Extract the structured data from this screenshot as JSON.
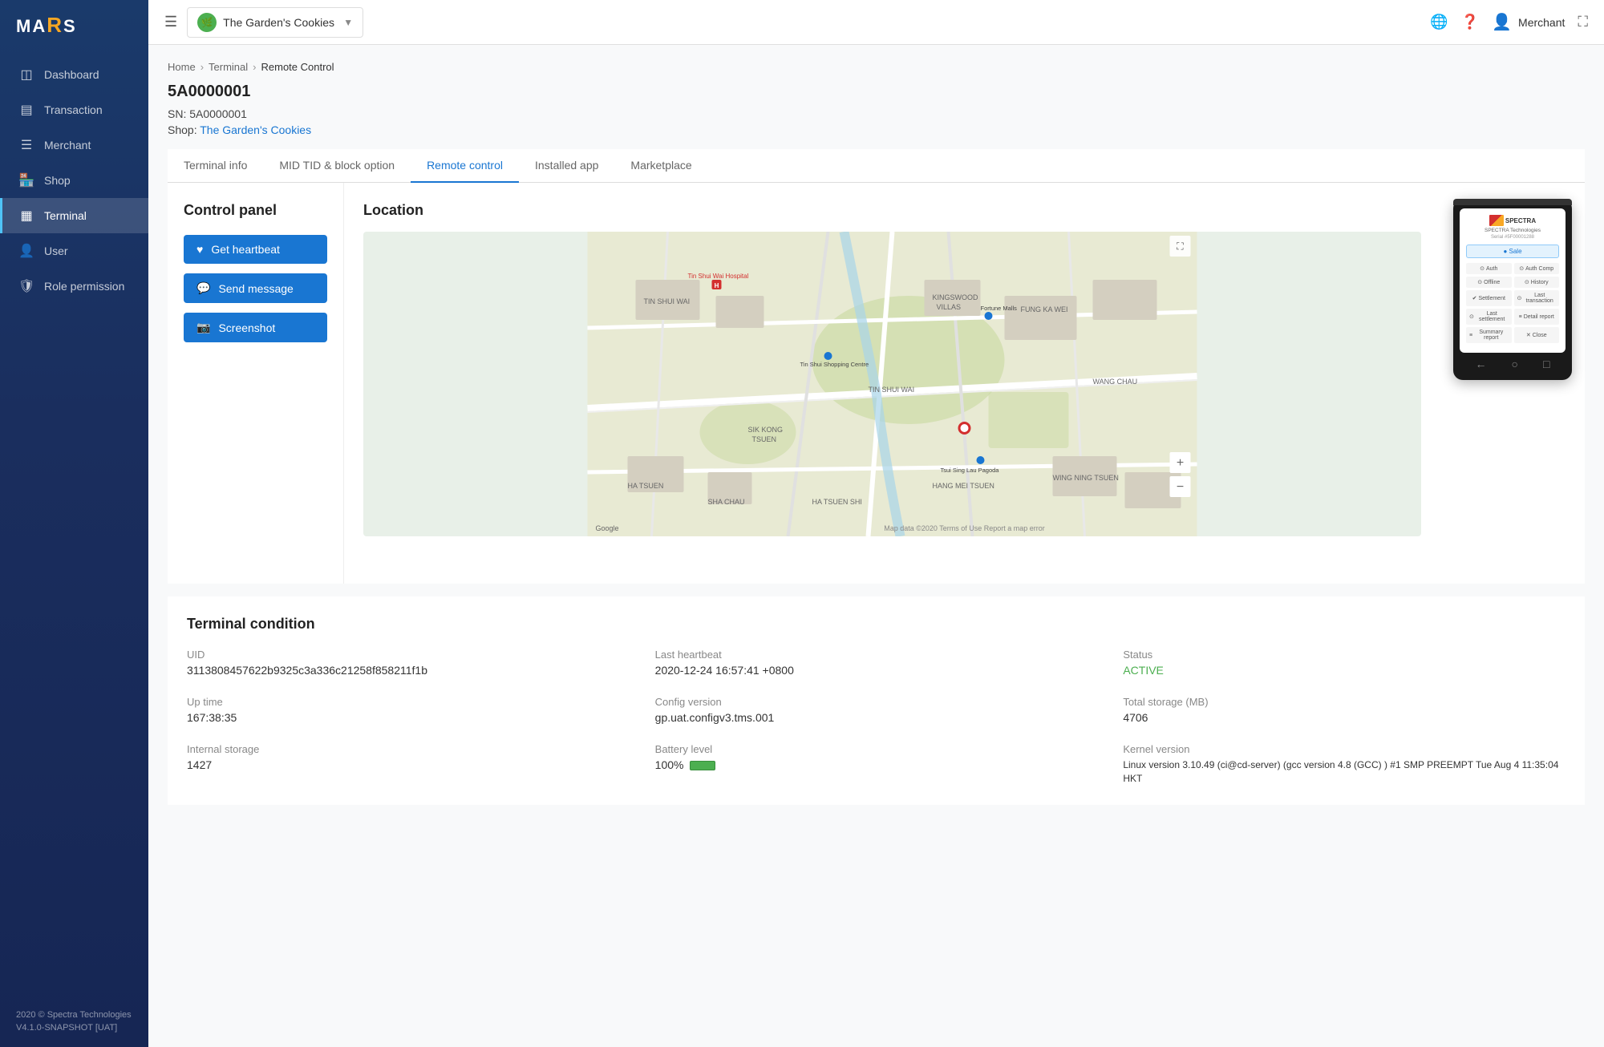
{
  "sidebar": {
    "logo": "MARS",
    "nav_items": [
      {
        "id": "dashboard",
        "label": "Dashboard",
        "icon": "🏠",
        "active": false
      },
      {
        "id": "transaction",
        "label": "Transaction",
        "icon": "💳",
        "active": false
      },
      {
        "id": "merchant",
        "label": "Merchant",
        "icon": "📋",
        "active": false
      },
      {
        "id": "shop",
        "label": "Shop",
        "icon": "🏪",
        "active": false
      },
      {
        "id": "terminal",
        "label": "Terminal",
        "icon": "🖥",
        "active": true
      },
      {
        "id": "user",
        "label": "User",
        "icon": "👤",
        "active": false
      },
      {
        "id": "role-permission",
        "label": "Role permission",
        "icon": "🛡",
        "active": false
      }
    ],
    "footer": "2020 © Spectra Technologies\nV4.1.0-SNAPSHOT [UAT]"
  },
  "topbar": {
    "menu_icon": "☰",
    "shop": {
      "name": "The Garden's Cookies",
      "icon": "🌿"
    },
    "icons": {
      "globe": "🌐",
      "help": "❓",
      "user": "👤",
      "fullscreen": "⛶"
    },
    "username": "Merchant"
  },
  "breadcrumb": {
    "items": [
      "Home",
      "Terminal",
      "Remote Control"
    ]
  },
  "page": {
    "title": "5A0000001",
    "sn_label": "SN:",
    "sn_value": "5A0000001",
    "shop_label": "Shop:",
    "shop_link": "The Garden's Cookies"
  },
  "tabs": [
    {
      "id": "terminal-info",
      "label": "Terminal info",
      "active": false
    },
    {
      "id": "mid-tid",
      "label": "MID TID & block option",
      "active": false
    },
    {
      "id": "remote-control",
      "label": "Remote control",
      "active": true
    },
    {
      "id": "installed-app",
      "label": "Installed app",
      "active": false
    },
    {
      "id": "marketplace",
      "label": "Marketplace",
      "active": false
    }
  ],
  "control_panel": {
    "title": "Control panel",
    "buttons": [
      {
        "id": "get-heartbeat",
        "label": "Get heartbeat",
        "icon": "♥"
      },
      {
        "id": "send-message",
        "label": "Send message",
        "icon": "💬"
      },
      {
        "id": "screenshot",
        "label": "Screenshot",
        "icon": "📷"
      }
    ]
  },
  "location": {
    "title": "Location",
    "map_credit": "Map data ©2020",
    "terms": "Terms of Use",
    "report": "Report a map error"
  },
  "device": {
    "brand": "SPECTRA Technologies",
    "serial": "Serial #5F00001288",
    "sale_btn": "● Sale",
    "buttons": [
      {
        "label": "Auth",
        "icon": "⊙"
      },
      {
        "label": "Auth Comp",
        "icon": "⊙"
      },
      {
        "label": "Offline",
        "icon": "⊙"
      },
      {
        "label": "History",
        "icon": "⊙"
      },
      {
        "label": "Settlement",
        "icon": "✔"
      },
      {
        "label": "Last transaction",
        "icon": "⊙"
      },
      {
        "label": "Last settlement",
        "icon": "⊙"
      },
      {
        "label": "Detail report",
        "icon": "⊙"
      },
      {
        "label": "Summary report",
        "icon": "≡"
      },
      {
        "label": "Close",
        "icon": "✕"
      }
    ]
  },
  "terminal_condition": {
    "title": "Terminal condition",
    "fields": [
      {
        "label": "UID",
        "value": "3113808457622b9325c3a336c21258f858211f1b"
      },
      {
        "label": "Last heartbeat",
        "value": "2020-12-24 16:57:41 +0800"
      },
      {
        "label": "Status",
        "value": "ACTIVE",
        "type": "status"
      },
      {
        "label": "Up time",
        "value": "167:38:35"
      },
      {
        "label": "Config version",
        "value": "gp.uat.configv3.tms.001"
      },
      {
        "label": "Total storage (MB)",
        "value": "4706"
      },
      {
        "label": "Internal storage",
        "value": "1427"
      },
      {
        "label": "Battery level",
        "value": "100%",
        "type": "battery"
      },
      {
        "label": "Kernel version",
        "value": "Linux version 3.10.49 (ci@cd-server) (gcc version 4.8 (GCC) ) #1 SMP PREEMPT Tue Aug 4 11:35:04 HKT"
      }
    ]
  }
}
